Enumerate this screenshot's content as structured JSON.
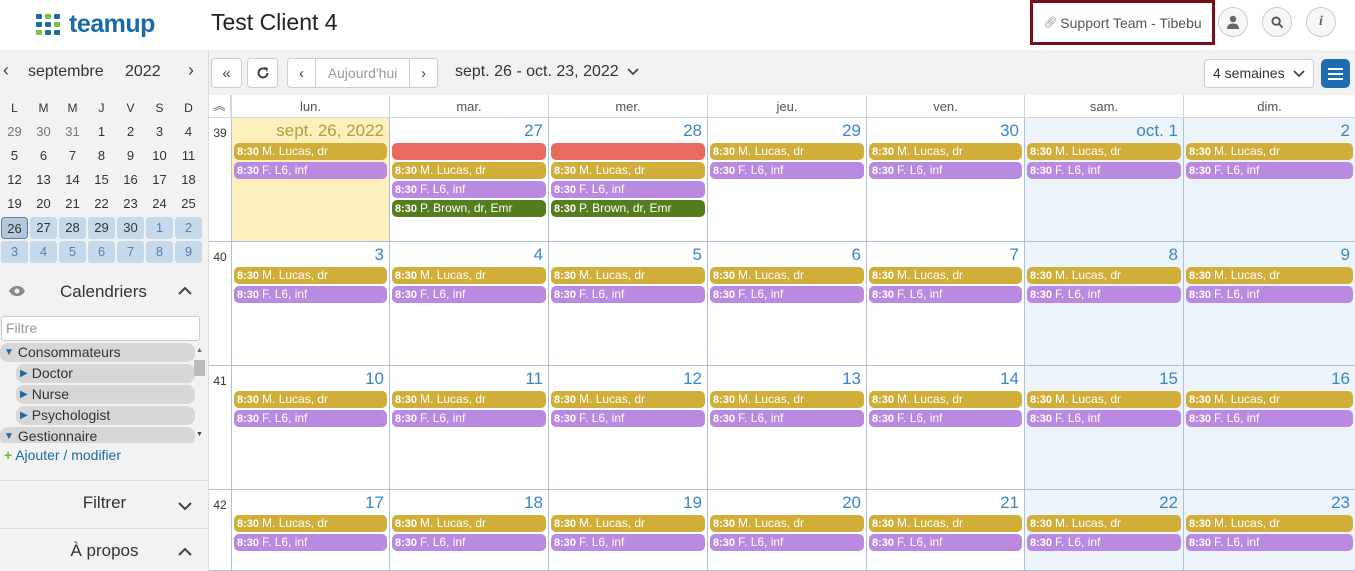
{
  "header": {
    "logo_text": "teamup",
    "calendar_title": "Test Client 4",
    "support_link": "Support Team - Tibebu",
    "buttons": {
      "account": "user-icon",
      "search": "search-icon",
      "info": "info-icon"
    }
  },
  "sidebar": {
    "mini_month": "septembre",
    "mini_year": "2022",
    "dow": [
      "L",
      "M",
      "M",
      "J",
      "V",
      "S",
      "D"
    ],
    "weeks": [
      [
        "29",
        "30",
        "31",
        "1",
        "2",
        "3",
        "4"
      ],
      [
        "5",
        "6",
        "7",
        "8",
        "9",
        "10",
        "11"
      ],
      [
        "12",
        "13",
        "14",
        "15",
        "16",
        "17",
        "18"
      ],
      [
        "19",
        "20",
        "21",
        "22",
        "23",
        "24",
        "25"
      ],
      [
        "26",
        "27",
        "28",
        "29",
        "30",
        "1",
        "2"
      ],
      [
        "3",
        "4",
        "5",
        "6",
        "7",
        "8",
        "9"
      ]
    ],
    "calendars_label": "Calendriers",
    "filter_placeholder": "Filtre",
    "calendar_items": [
      "Consommateurs",
      "Doctor",
      "Nurse",
      "Psychologist",
      "Gestionnaire"
    ],
    "add_modify": "Ajouter / modifier",
    "filter_section": "Filtrer",
    "about_section": "À propos"
  },
  "toolbar": {
    "today": "Aujourd'hui",
    "date_range": "sept. 26 - oct. 23, 2022",
    "view": "4 semaines"
  },
  "grid": {
    "days_of_week": [
      "lun.",
      "mar.",
      "mer.",
      "jeu.",
      "ven.",
      "sam.",
      "dim."
    ],
    "weeks": [
      {
        "num": "39",
        "days": [
          {
            "label": "sept. 26, 2022",
            "events": [
              {
                "time": "8:30",
                "title": "M. Lucas, dr",
                "color": "gold"
              },
              {
                "time": "8:30",
                "title": "F. L6, inf",
                "color": "purple"
              }
            ]
          },
          {
            "label": "27",
            "events": [
              {
                "time": "",
                "title": "",
                "color": "red"
              },
              {
                "time": "8:30",
                "title": "M. Lucas, dr",
                "color": "gold"
              },
              {
                "time": "8:30",
                "title": "F. L6, inf",
                "color": "purple"
              },
              {
                "time": "8:30",
                "title": "P. Brown, dr, Emr",
                "color": "green"
              }
            ]
          },
          {
            "label": "28",
            "events": [
              {
                "time": "",
                "title": "",
                "color": "red"
              },
              {
                "time": "8:30",
                "title": "M. Lucas, dr",
                "color": "gold"
              },
              {
                "time": "8:30",
                "title": "F. L6, inf",
                "color": "purple"
              },
              {
                "time": "8:30",
                "title": "P. Brown, dr, Emr",
                "color": "green"
              }
            ]
          },
          {
            "label": "29",
            "events": [
              {
                "time": "8:30",
                "title": "M. Lucas, dr",
                "color": "gold"
              },
              {
                "time": "8:30",
                "title": "F. L6, inf",
                "color": "purple"
              }
            ]
          },
          {
            "label": "30",
            "events": [
              {
                "time": "8:30",
                "title": "M. Lucas, dr",
                "color": "gold"
              },
              {
                "time": "8:30",
                "title": "F. L6, inf",
                "color": "purple"
              }
            ]
          },
          {
            "label": "oct. 1",
            "events": [
              {
                "time": "8:30",
                "title": "M. Lucas, dr",
                "color": "gold"
              },
              {
                "time": "8:30",
                "title": "F. L6, inf",
                "color": "purple"
              }
            ]
          },
          {
            "label": "2",
            "events": [
              {
                "time": "8:30",
                "title": "M. Lucas, dr",
                "color": "gold"
              },
              {
                "time": "8:30",
                "title": "F. L6, inf",
                "color": "purple"
              }
            ]
          }
        ]
      },
      {
        "num": "40",
        "days": [
          {
            "label": "3",
            "events": [
              {
                "time": "8:30",
                "title": "M. Lucas, dr",
                "color": "gold"
              },
              {
                "time": "8:30",
                "title": "F. L6, inf",
                "color": "purple"
              }
            ]
          },
          {
            "label": "4",
            "events": [
              {
                "time": "8:30",
                "title": "M. Lucas, dr",
                "color": "gold"
              },
              {
                "time": "8:30",
                "title": "F. L6, inf",
                "color": "purple"
              }
            ]
          },
          {
            "label": "5",
            "events": [
              {
                "time": "8:30",
                "title": "M. Lucas, dr",
                "color": "gold"
              },
              {
                "time": "8:30",
                "title": "F. L6, inf",
                "color": "purple"
              }
            ]
          },
          {
            "label": "6",
            "events": [
              {
                "time": "8:30",
                "title": "M. Lucas, dr",
                "color": "gold"
              },
              {
                "time": "8:30",
                "title": "F. L6, inf",
                "color": "purple"
              }
            ]
          },
          {
            "label": "7",
            "events": [
              {
                "time": "8:30",
                "title": "M. Lucas, dr",
                "color": "gold"
              },
              {
                "time": "8:30",
                "title": "F. L6, inf",
                "color": "purple"
              }
            ]
          },
          {
            "label": "8",
            "events": [
              {
                "time": "8:30",
                "title": "M. Lucas, dr",
                "color": "gold"
              },
              {
                "time": "8:30",
                "title": "F. L6, inf",
                "color": "purple"
              }
            ]
          },
          {
            "label": "9",
            "events": [
              {
                "time": "8:30",
                "title": "M. Lucas, dr",
                "color": "gold"
              },
              {
                "time": "8:30",
                "title": "F. L6, inf",
                "color": "purple"
              }
            ]
          }
        ]
      },
      {
        "num": "41",
        "days": [
          {
            "label": "10",
            "events": [
              {
                "time": "8:30",
                "title": "M. Lucas, dr",
                "color": "gold"
              },
              {
                "time": "8:30",
                "title": "F. L6, inf",
                "color": "purple"
              }
            ]
          },
          {
            "label": "11",
            "events": [
              {
                "time": "8:30",
                "title": "M. Lucas, dr",
                "color": "gold"
              },
              {
                "time": "8:30",
                "title": "F. L6, inf",
                "color": "purple"
              }
            ]
          },
          {
            "label": "12",
            "events": [
              {
                "time": "8:30",
                "title": "M. Lucas, dr",
                "color": "gold"
              },
              {
                "time": "8:30",
                "title": "F. L6, inf",
                "color": "purple"
              }
            ]
          },
          {
            "label": "13",
            "events": [
              {
                "time": "8:30",
                "title": "M. Lucas, dr",
                "color": "gold"
              },
              {
                "time": "8:30",
                "title": "F. L6, inf",
                "color": "purple"
              }
            ]
          },
          {
            "label": "14",
            "events": [
              {
                "time": "8:30",
                "title": "M. Lucas, dr",
                "color": "gold"
              },
              {
                "time": "8:30",
                "title": "F. L6, inf",
                "color": "purple"
              }
            ]
          },
          {
            "label": "15",
            "events": [
              {
                "time": "8:30",
                "title": "M. Lucas, dr",
                "color": "gold"
              },
              {
                "time": "8:30",
                "title": "F. L6, inf",
                "color": "purple"
              }
            ]
          },
          {
            "label": "16",
            "events": [
              {
                "time": "8:30",
                "title": "M. Lucas, dr",
                "color": "gold"
              },
              {
                "time": "8:30",
                "title": "F. L6, inf",
                "color": "purple"
              }
            ]
          }
        ]
      },
      {
        "num": "42",
        "days": [
          {
            "label": "17",
            "events": [
              {
                "time": "8:30",
                "title": "M. Lucas, dr",
                "color": "gold"
              },
              {
                "time": "8:30",
                "title": "F. L6, inf",
                "color": "purple"
              }
            ]
          },
          {
            "label": "18",
            "events": [
              {
                "time": "8:30",
                "title": "M. Lucas, dr",
                "color": "gold"
              },
              {
                "time": "8:30",
                "title": "F. L6, inf",
                "color": "purple"
              }
            ]
          },
          {
            "label": "19",
            "events": [
              {
                "time": "8:30",
                "title": "M. Lucas, dr",
                "color": "gold"
              },
              {
                "time": "8:30",
                "title": "F. L6, inf",
                "color": "purple"
              }
            ]
          },
          {
            "label": "20",
            "events": [
              {
                "time": "8:30",
                "title": "M. Lucas, dr",
                "color": "gold"
              },
              {
                "time": "8:30",
                "title": "F. L6, inf",
                "color": "purple"
              }
            ]
          },
          {
            "label": "21",
            "events": [
              {
                "time": "8:30",
                "title": "M. Lucas, dr",
                "color": "gold"
              },
              {
                "time": "8:30",
                "title": "F. L6, inf",
                "color": "purple"
              }
            ]
          },
          {
            "label": "22",
            "events": [
              {
                "time": "8:30",
                "title": "M. Lucas, dr",
                "color": "gold"
              },
              {
                "time": "8:30",
                "title": "F. L6, inf",
                "color": "purple"
              }
            ]
          },
          {
            "label": "23",
            "events": [
              {
                "time": "8:30",
                "title": "M. Lucas, dr",
                "color": "gold"
              },
              {
                "time": "8:30",
                "title": "F. L6, inf",
                "color": "purple"
              }
            ]
          }
        ]
      }
    ]
  },
  "colors": {
    "brand": "#1a6aa8",
    "gold": "#d1ae39",
    "purple": "#b98ae0",
    "red": "#e96a5e",
    "green": "#567d1d",
    "today_bg": "#fdf0bd",
    "weekend_bg": "#edf4f9"
  }
}
